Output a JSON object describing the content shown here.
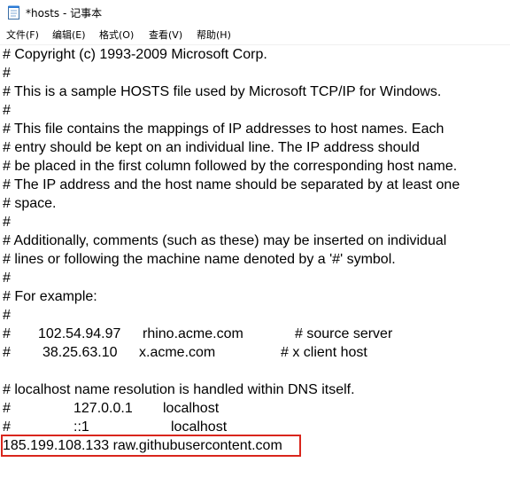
{
  "window": {
    "title": "*hosts - 记事本",
    "app_icon": "notepad-icon"
  },
  "menu": {
    "items": [
      "文件(F)",
      "编辑(E)",
      "格式(O)",
      "查看(V)",
      "帮助(H)"
    ]
  },
  "editor": {
    "lines": [
      "# Copyright (c) 1993-2009 Microsoft Corp.",
      "#",
      "# This is a sample HOSTS file used by Microsoft TCP/IP for Windows.",
      "#",
      "# This file contains the mappings of IP addresses to host names. Each",
      "# entry should be kept on an individual line. The IP address should",
      "# be placed in the first column followed by the corresponding host name.",
      "# The IP address and the host name should be separated by at least one",
      "# space.",
      "#",
      "# Additionally, comments (such as these) may be inserted on individual",
      "# lines or following the machine name denoted by a '#' symbol.",
      "#",
      "# For example:",
      "#"
    ],
    "example_rows": [
      {
        "hash": "#",
        "ip": "102.54.94.97",
        "host": "rhino.acme.com",
        "comment": "# source server"
      },
      {
        "hash": "#",
        "ip": "38.25.63.10",
        "host": "x.acme.com",
        "comment": "# x client host"
      }
    ],
    "dns_comment": "# localhost name resolution is handled within DNS itself.",
    "localhost_rows": [
      {
        "hash": "#",
        "ip": "127.0.0.1",
        "host": "localhost"
      },
      {
        "hash": "#",
        "ip": "::1",
        "host": "localhost"
      }
    ],
    "added_entry": "185.199.108.133 raw.githubusercontent.com",
    "highlight_color": "#d9261c"
  }
}
